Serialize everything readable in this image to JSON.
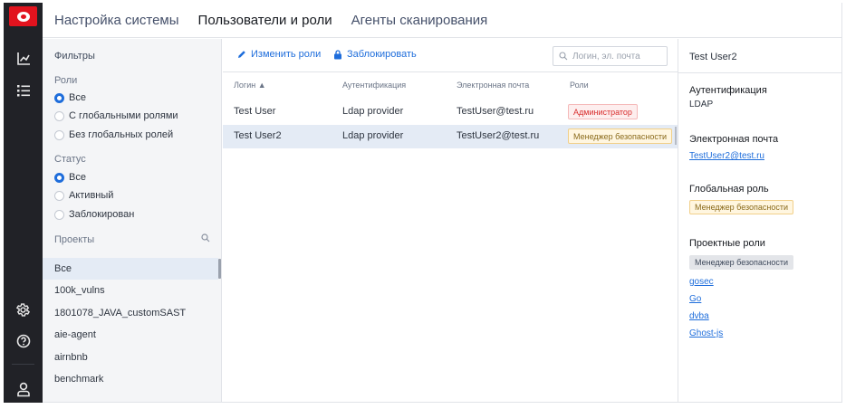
{
  "nav_tabs": [
    {
      "label": "Настройка системы"
    },
    {
      "label": "Пользователи и роли"
    },
    {
      "label": "Агенты сканирования"
    }
  ],
  "rail_icons": [
    "logo-icon",
    "chart-icon",
    "list-icon",
    "gear-icon",
    "help-icon",
    "user-icon"
  ],
  "filters": {
    "title": "Фильтры",
    "roles_label": "Роли",
    "roles_options": [
      "Все",
      "С глобальными ролями",
      "Без глобальных ролей"
    ],
    "roles_selected": "Все",
    "status_label": "Статус",
    "status_options": [
      "Все",
      "Активный",
      "Заблокирован"
    ],
    "status_selected": "Все",
    "projects_label": "Проекты",
    "projects": [
      "Все",
      "100k_vulns",
      "1801078_JAVA_customSAST",
      "aie-agent",
      "airnbnb",
      "benchmark"
    ],
    "projects_selected": "Все"
  },
  "toolbar": {
    "edit_roles": "Изменить роли",
    "block": "Заблокировать",
    "search_placeholder": "Логин, эл. почта"
  },
  "table": {
    "columns": [
      "Логин ▲",
      "Аутентификация",
      "Электронная почта",
      "Роли"
    ],
    "rows": [
      {
        "login": "Test User",
        "auth": "Ldap provider",
        "email": "TestUser@test.ru",
        "role": "Администратор",
        "role_color": "#d92d2d"
      },
      {
        "login": "Test User2",
        "auth": "Ldap provider",
        "email": "TestUser2@test.ru",
        "role": "Менеджер безопасности",
        "role_color": "#f1d08a"
      }
    ],
    "selected_row": 1
  },
  "details": {
    "title": "Test User2",
    "auth_label": "Аутентификация",
    "auth_value": "LDAP",
    "email_label": "Электронная почта",
    "email_value": "TestUser2@test.ru",
    "global_role_label": "Глобальная роль",
    "global_role": "Менеджер безопасности",
    "project_roles_label": "Проектные роли",
    "project_role": "Менеджер безопасности",
    "projects": [
      "gosec",
      "Go",
      "dvba",
      "Ghost-js"
    ]
  },
  "colors": {
    "accent": "#1e6ddb",
    "brand": "#e2131e",
    "rail": "#212227",
    "selected_row": "#e4ebf5"
  }
}
